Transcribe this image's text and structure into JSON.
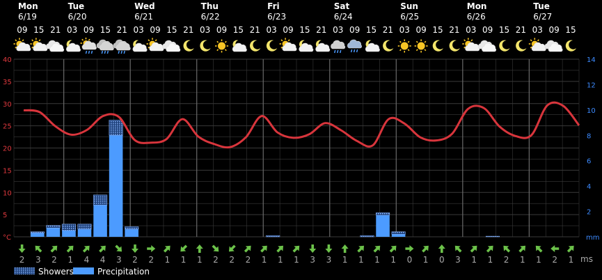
{
  "days": [
    {
      "name": "Mon",
      "date": "6/19"
    },
    {
      "name": "Tue",
      "date": "6/20"
    },
    {
      "name": "Wed",
      "date": "6/21"
    },
    {
      "name": "Thu",
      "date": "6/22"
    },
    {
      "name": "Fri",
      "date": "6/23"
    },
    {
      "name": "Sat",
      "date": "6/24"
    },
    {
      "name": "Sun",
      "date": "6/25"
    },
    {
      "name": "Mon",
      "date": "6/26"
    },
    {
      "name": "Tue",
      "date": "6/27"
    }
  ],
  "colors": {
    "temperature": "#d8353c",
    "precipitation": "#4c9bff",
    "wind_arrow": "#6cc24a",
    "grid": "#3a3a3a",
    "left_axis": "#e0393e",
    "right_axis": "#3d8bff"
  },
  "axis_units": {
    "left": "°C",
    "right": "mm",
    "wind": "ms"
  },
  "legend": {
    "showers": "Showers",
    "precipitation": "Precipitation"
  },
  "chart_data": {
    "type": "meteogram",
    "x": [
      "09",
      "15",
      "21",
      "03",
      "09",
      "15",
      "21",
      "03",
      "09",
      "15",
      "21",
      "03",
      "09",
      "15",
      "21",
      "03",
      "09",
      "15",
      "21",
      "03",
      "09",
      "15",
      "21",
      "03",
      "09",
      "15",
      "21",
      "03",
      "09",
      "15",
      "21",
      "03",
      "09",
      "15"
    ],
    "icons": [
      "sun-cloud",
      "sun-cloud",
      "cloud",
      "moon-cloud",
      "rain-sun",
      "rain-cloud",
      "rain-cloud",
      "moon-cloud",
      "sun-cloud",
      "cloud",
      "moon",
      "moon",
      "sun",
      "moon-cloud",
      "moon",
      "moon",
      "sun-cloud",
      "moon-cloud",
      "moon-cloud",
      "cloud-rain",
      "rain",
      "moon-cloud",
      "moon",
      "sun",
      "sun",
      "moon",
      "moon",
      "sun-cloud",
      "cloud",
      "moon",
      "moon",
      "sun-cloud",
      "cloud",
      "moon"
    ],
    "temperature": {
      "ylim": [
        0,
        40
      ],
      "ticks": [
        40,
        35,
        30,
        25,
        20,
        15,
        10,
        5
      ],
      "values": [
        28.5,
        28.1,
        24.9,
        23.0,
        24.1,
        27.2,
        27.0,
        21.8,
        21.2,
        22.0,
        26.5,
        22.6,
        20.9,
        20.2,
        22.4,
        27.2,
        23.5,
        22.3,
        23.1,
        25.6,
        24.0,
        21.6,
        20.6,
        26.5,
        25.5,
        22.4,
        21.7,
        23.2,
        28.8,
        29.0,
        24.8,
        22.7,
        22.9,
        29.6,
        29.5,
        25.1
      ]
    },
    "precipitation": {
      "ylim": [
        0,
        14
      ],
      "ticks": [
        14,
        12,
        10,
        8,
        6,
        4,
        2
      ],
      "values": [
        0,
        0.3,
        0.7,
        0.5,
        0.6,
        2.5,
        8.0,
        0.6,
        0,
        0,
        0,
        0,
        0,
        0,
        0,
        0,
        0,
        0,
        0,
        0,
        0,
        0,
        0,
        1.7,
        0.2,
        0,
        0,
        0,
        0,
        0,
        0,
        0,
        0,
        0,
        0,
        0
      ],
      "showers": [
        0,
        0.1,
        0.2,
        0.5,
        0.4,
        0.8,
        1.2,
        0.2,
        0,
        0,
        0,
        0,
        0,
        0,
        0,
        0,
        0.1,
        0,
        0,
        0,
        0,
        0,
        0.1,
        0.2,
        0.2,
        0,
        0,
        0,
        0,
        0,
        0.05,
        0,
        0,
        0,
        0,
        0
      ]
    },
    "wind": {
      "directions": [
        "S",
        "NW",
        "NE",
        "NE",
        "NE",
        "NE",
        "SE",
        "S",
        "E",
        "NE",
        "SW",
        "N",
        "SE",
        "SW",
        "NE",
        "NE",
        "NE",
        "NE",
        "S",
        "S",
        "N",
        "NE",
        "NE",
        "NE",
        "E",
        "NE",
        "N",
        "NW",
        "NE",
        "NE",
        "NW",
        "NE",
        "NW",
        "W",
        "NE"
      ],
      "speeds": [
        2,
        3,
        2,
        1,
        4,
        4,
        3,
        2,
        2,
        1,
        1,
        1,
        2,
        2,
        2,
        1,
        1,
        1,
        3,
        3,
        1,
        1,
        1,
        1,
        0,
        1,
        0,
        3,
        1,
        1,
        2,
        1,
        1,
        2,
        1
      ]
    }
  }
}
